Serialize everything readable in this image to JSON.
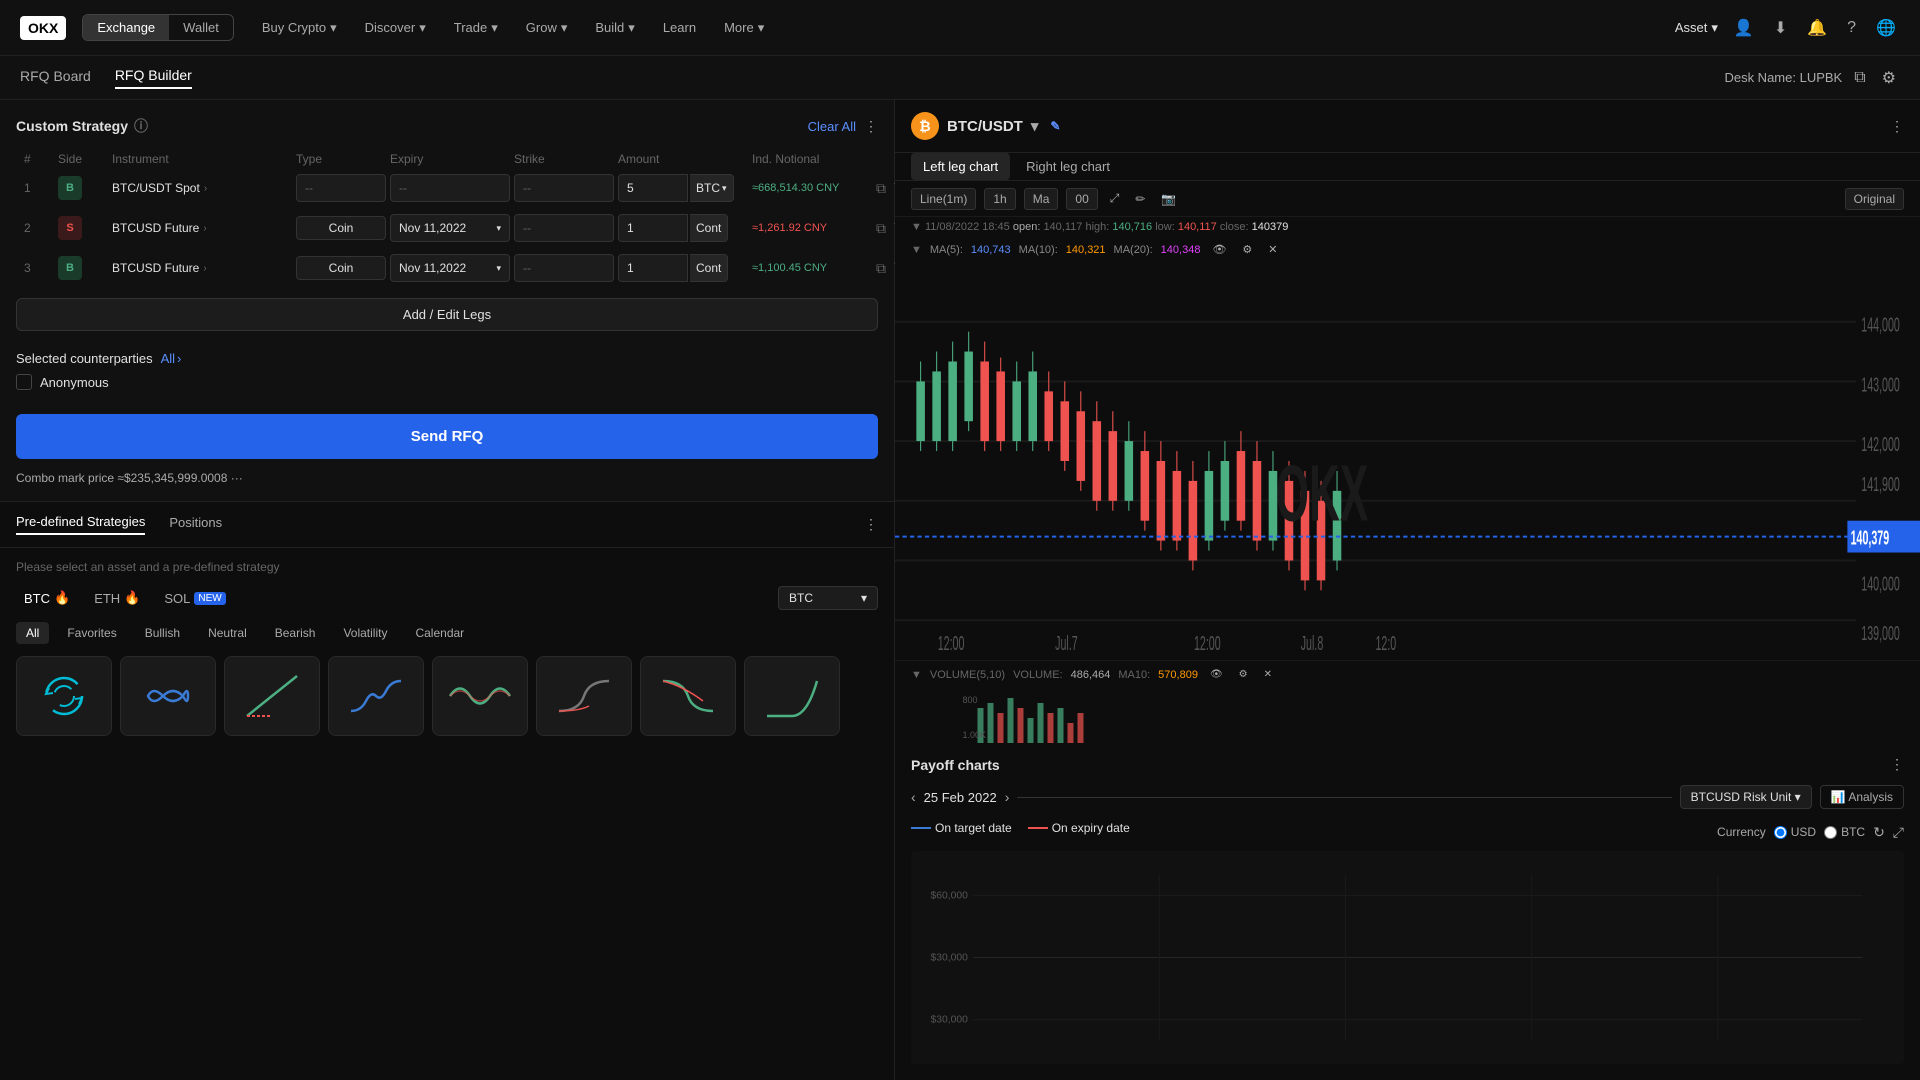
{
  "nav": {
    "logo": "OKX",
    "exchange_label": "Exchange",
    "wallet_label": "Wallet",
    "links": [
      "Buy Crypto",
      "Discover",
      "Trade",
      "Grow",
      "Build",
      "Learn",
      "More"
    ],
    "asset_label": "Asset",
    "desk_name": "Desk Name: LUPBK"
  },
  "sub_nav": {
    "tabs": [
      "RFQ Board",
      "RFQ Builder"
    ]
  },
  "strategy": {
    "title": "Custom Strategy",
    "clear_all": "Clear All",
    "columns": [
      "#",
      "Side",
      "Instrument",
      "Type",
      "Expiry",
      "Strike",
      "Amount",
      "Ind. Notional",
      ""
    ],
    "rows": [
      {
        "num": "1",
        "side": "B",
        "side_type": "buy",
        "instrument": "BTC/USDT Spot",
        "type": "--",
        "expiry": "--",
        "strike": "--",
        "amount": "5",
        "unit": "BTC",
        "notional": "≈668,514.30 CNY"
      },
      {
        "num": "2",
        "side": "S",
        "side_type": "sell",
        "instrument": "BTCUSD Future",
        "type": "Coin",
        "expiry": "Nov 11,2022",
        "strike": "--",
        "amount": "1",
        "unit": "Cont",
        "notional": "≈1,261.92 CNY"
      },
      {
        "num": "3",
        "side": "B",
        "side_type": "buy",
        "instrument": "BTCUSD Future",
        "type": "Coin",
        "expiry": "Nov 11,2022",
        "strike": "--",
        "amount": "1",
        "unit": "Cont",
        "notional": "≈1,100.45 CNY"
      }
    ],
    "add_legs": "Add / Edit Legs",
    "counterparties_label": "Selected counterparties",
    "all_label": "All",
    "anonymous_label": "Anonymous",
    "send_rfq": "Send RFQ",
    "combo_price_label": "Combo mark price",
    "combo_price_value": "≈$235,345,999.0008"
  },
  "chart": {
    "pair": "BTC/USDT",
    "tabs": [
      "Left leg chart",
      "Right leg chart"
    ],
    "timeframe": "Line(1m)",
    "interval": "1h",
    "type": "Ma",
    "date": "11/08/2022 18:45",
    "open": "140,117",
    "high": "140,716",
    "low": "140,117",
    "close": "140379",
    "ma5": "140,743",
    "ma10": "140,321",
    "ma20": "140,348",
    "current_price": "140,379",
    "y_labels": [
      "144,000",
      "143,000",
      "142,000",
      "141,900",
      "140,000",
      "139,000"
    ],
    "x_labels": [
      "12:00",
      "Jul.7",
      "12:00",
      "Jul.8",
      "12:0"
    ],
    "volume_label": "VOLUME(5,10)",
    "volume_value": "486,464",
    "ma10_vol": "570,809",
    "original_label": "Original"
  },
  "payoff": {
    "title": "Payoff charts",
    "date": "25 Feb 2022",
    "risk_unit": "BTCUSD Risk Unit",
    "analysis_btn": "Analysis",
    "on_target_label": "On target date",
    "on_expiry_label": "On expiry date",
    "currency_label": "Currency",
    "currency_usd": "USD",
    "currency_btc": "BTC",
    "y_labels": [
      "$60,000",
      "$30,000",
      "$30,000"
    ]
  },
  "bottom": {
    "tabs": [
      "Pre-defined Strategies",
      "Positions"
    ],
    "desc": "Please select an asset and a pre-defined strategy",
    "assets": [
      "BTC",
      "ETH",
      "SOL"
    ],
    "filters": [
      "All",
      "Favorites",
      "Bullish",
      "Neutral",
      "Bearish",
      "Volatility",
      "Calendar"
    ],
    "btc_select": "BTC"
  }
}
